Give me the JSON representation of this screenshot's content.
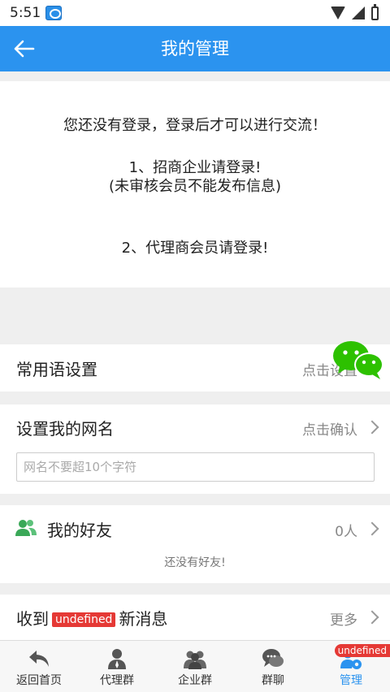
{
  "status_bar": {
    "time": "5:51"
  },
  "app_bar": {
    "title": "我的管理"
  },
  "login_notice": {
    "line1": "您还没有登录，登录后才可以进行交流！",
    "line2": "1、招商企业请登录!",
    "line3": "(未审核会员不能发布信息)",
    "line4": "2、代理商会员请登录!"
  },
  "phrases_row": {
    "label": "常用语设置",
    "action": "点击设置"
  },
  "nickname_row": {
    "label": "设置我的网名",
    "action": "点击确认",
    "input_placeholder": "网名不要超10个字符",
    "input_value": ""
  },
  "friends_row": {
    "label": "我的好友",
    "count": "0人",
    "empty_text": "还没有好友!"
  },
  "messages_row": {
    "label_prefix": "收到",
    "badge": "undefined",
    "label_suffix": "新消息",
    "action": "更多"
  },
  "tab_bar": {
    "tabs": [
      {
        "label": "返回首页",
        "icon": "reply-arrow-icon"
      },
      {
        "label": "代理群",
        "icon": "agent-person-icon"
      },
      {
        "label": "企业群",
        "icon": "company-group-icon"
      },
      {
        "label": "群聊",
        "icon": "chat-bubbles-icon"
      },
      {
        "label": "管理",
        "icon": "manage-user-gear-icon",
        "badge": "undefined"
      }
    ],
    "active_index": 4
  },
  "colors": {
    "primary": "#2b93ef",
    "badge_red": "#e53935",
    "wechat_green": "#2dc100"
  }
}
